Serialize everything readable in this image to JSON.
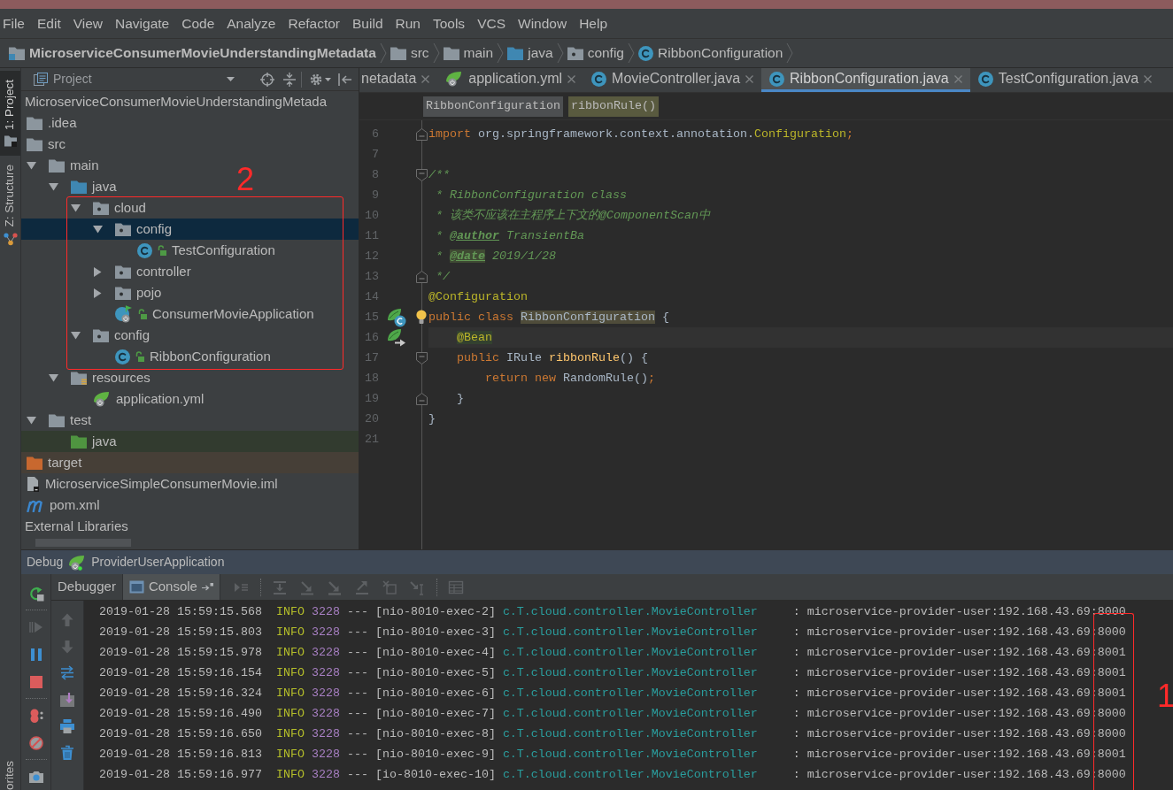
{
  "menu_bar": [
    {
      "label": "File"
    },
    {
      "label": "Edit"
    },
    {
      "label": "View"
    },
    {
      "label": "Navigate"
    },
    {
      "label": "Code"
    },
    {
      "label": "Analyze"
    },
    {
      "label": "Refactor"
    },
    {
      "label": "Build"
    },
    {
      "label": "Run"
    },
    {
      "label": "Tools"
    },
    {
      "label": "VCS"
    },
    {
      "label": "Window"
    },
    {
      "label": "Help"
    }
  ],
  "navigation_bar": [
    {
      "label": "MicroserviceConsumerMovieUnderstandingMetadata",
      "kind": "module"
    },
    {
      "label": "src",
      "kind": "folder"
    },
    {
      "label": "main",
      "kind": "folder"
    },
    {
      "label": "java",
      "kind": "source_root"
    },
    {
      "label": "config",
      "kind": "package"
    },
    {
      "label": "RibbonConfiguration",
      "kind": "class"
    }
  ],
  "tool_strip": {
    "top": [
      {
        "label": "1: Project",
        "kind": "project",
        "selected": true
      },
      {
        "label": "Z: Structure",
        "kind": "structure",
        "selected": false
      }
    ],
    "bottom": [
      {
        "label": "orites"
      }
    ]
  },
  "project_panel": {
    "title": "Project",
    "annotation": {
      "label": "2"
    },
    "tree": [
      {
        "label": "MicroserviceConsumerMovieUnderstandingMetada",
        "selected": false,
        "children": [
          {
            "label": ".idea",
            "kind": "folder",
            "selected": false
          },
          {
            "label": "src",
            "kind": "folder",
            "selected": false,
            "children": [
              {
                "label": "main",
                "kind": "folder",
                "expanded": true,
                "selected": false,
                "children": [
                  {
                    "label": "java",
                    "kind": "source_root",
                    "expanded": true,
                    "selected": false,
                    "children": [
                      {
                        "label": "cloud",
                        "kind": "package",
                        "expanded": true,
                        "selected": false,
                        "children": [
                          {
                            "label": "config",
                            "kind": "package",
                            "expanded": true,
                            "selected": true,
                            "children": [
                              {
                                "label": "TestConfiguration",
                                "kind": "class",
                                "selected": false
                              }
                            ]
                          },
                          {
                            "label": "controller",
                            "kind": "package",
                            "expanded": false,
                            "selected": false
                          },
                          {
                            "label": "pojo",
                            "kind": "package",
                            "expanded": false,
                            "selected": false
                          },
                          {
                            "label": "ConsumerMovieApplication",
                            "kind": "boot_class",
                            "selected": false
                          }
                        ]
                      },
                      {
                        "label": "config",
                        "kind": "package",
                        "expanded": true,
                        "selected": false,
                        "children": [
                          {
                            "label": "RibbonConfiguration",
                            "kind": "class",
                            "selected": false
                          }
                        ]
                      }
                    ]
                  },
                  {
                    "label": "resources",
                    "kind": "resources_root",
                    "expanded": true,
                    "selected": false,
                    "children": [
                      {
                        "label": "application.yml",
                        "kind": "yml",
                        "selected": false
                      }
                    ]
                  }
                ]
              },
              {
                "label": "test",
                "kind": "folder",
                "expanded": true,
                "selected": false,
                "children": [
                  {
                    "label": "java",
                    "kind": "test_root",
                    "selected": false
                  }
                ]
              }
            ]
          },
          {
            "label": "target",
            "kind": "excluded",
            "selected": false
          },
          {
            "label": "MicroserviceSimpleConsumerMovie.iml",
            "kind": "iml",
            "selected": false
          },
          {
            "label": "pom.xml",
            "kind": "pom",
            "selected": false
          }
        ]
      },
      {
        "label": "External Libraries",
        "selected": false
      }
    ]
  },
  "editor": {
    "tabs": [
      {
        "label": "netadata",
        "kind": "clipped",
        "selected": false
      },
      {
        "label": "application.yml",
        "kind": "yml",
        "selected": false
      },
      {
        "label": "MovieController.java",
        "kind": "class",
        "selected": false
      },
      {
        "label": "RibbonConfiguration.java",
        "kind": "class",
        "selected": true
      },
      {
        "label": "TestConfiguration.java",
        "kind": "class",
        "selected": false
      }
    ],
    "breadcrumbs": [
      {
        "label": "RibbonConfiguration",
        "kind": "class"
      },
      {
        "label": "ribbonRule()",
        "kind": "method"
      }
    ],
    "lines": [
      {
        "number": "6",
        "fold_marker": {
          "kind": "end"
        },
        "current": false,
        "bulb": false,
        "tokens": [
          {
            "text": "import",
            "kind": "keyword",
            "highlighted": false
          },
          {
            "text": " org.springframework.context.annotation.",
            "kind": "plain",
            "highlighted": false
          },
          {
            "text": "Configuration",
            "kind": "annotation",
            "highlighted": false
          },
          {
            "text": ";",
            "kind": "keyword",
            "highlighted": false
          }
        ]
      },
      {
        "number": "7",
        "current": false,
        "bulb": false
      },
      {
        "number": "8",
        "fold_marker": {
          "kind": "start"
        },
        "current": false,
        "bulb": false,
        "tokens": [
          {
            "text": "/**",
            "kind": "comment",
            "highlighted": false
          }
        ]
      },
      {
        "number": "9",
        "current": false,
        "bulb": false,
        "tokens": [
          {
            "text": " * RibbonConfiguration class",
            "kind": "comment",
            "highlighted": false
          }
        ]
      },
      {
        "number": "10",
        "current": false,
        "bulb": false,
        "tokens": [
          {
            "text": " * 该类不应该在主程序上下文的@ComponentScan中",
            "kind": "comment",
            "highlighted": false
          }
        ]
      },
      {
        "number": "11",
        "current": false,
        "bulb": false,
        "tokens": [
          {
            "text": " * ",
            "kind": "comment",
            "highlighted": false
          },
          {
            "text": "@author",
            "kind": "doc_tag",
            "highlighted": false
          },
          {
            "text": " TransientBa",
            "kind": "comment",
            "highlighted": false
          }
        ]
      },
      {
        "number": "12",
        "current": false,
        "bulb": false,
        "tokens": [
          {
            "text": " * ",
            "kind": "comment",
            "highlighted": false
          },
          {
            "text": "@date",
            "kind": "doc_tag",
            "highlighted": true
          },
          {
            "text": " 2019/1/28",
            "kind": "comment",
            "highlighted": false
          }
        ]
      },
      {
        "number": "13",
        "fold_marker": {
          "kind": "end"
        },
        "current": false,
        "bulb": false,
        "tokens": [
          {
            "text": " */",
            "kind": "comment",
            "highlighted": false
          }
        ]
      },
      {
        "number": "14",
        "current": false,
        "bulb": false,
        "tokens": [
          {
            "text": "@Configuration",
            "kind": "annotation",
            "highlighted": false
          }
        ]
      },
      {
        "number": "15",
        "gutter_icon": {
          "kind": "bean_class"
        },
        "current": false,
        "bulb": true,
        "tokens": [
          {
            "text": "public class ",
            "kind": "keyword",
            "highlighted": false
          },
          {
            "text": "RibbonConfiguration",
            "kind": "plain",
            "highlighted": true
          },
          {
            "text": " {",
            "kind": "plain",
            "highlighted": false
          }
        ]
      },
      {
        "number": "16",
        "gutter_icon": {
          "kind": "bean_method"
        },
        "current": true,
        "bulb": false,
        "tokens": [
          {
            "text": "    @Bean",
            "kind": "annotation",
            "highlighted": true
          }
        ]
      },
      {
        "number": "17",
        "fold_marker": {
          "kind": "start"
        },
        "current": false,
        "bulb": false,
        "tokens": [
          {
            "text": "    public ",
            "kind": "keyword",
            "highlighted": false
          },
          {
            "text": "IRule ",
            "kind": "plain",
            "highlighted": false
          },
          {
            "text": "ribbonRule",
            "kind": "method",
            "highlighted": false
          },
          {
            "text": "() {",
            "kind": "plain",
            "highlighted": false
          }
        ]
      },
      {
        "number": "18",
        "current": false,
        "bulb": false,
        "tokens": [
          {
            "text": "        return new ",
            "kind": "keyword",
            "highlighted": false
          },
          {
            "text": "RandomRule()",
            "kind": "plain",
            "highlighted": false
          },
          {
            "text": ";",
            "kind": "keyword",
            "highlighted": false
          }
        ]
      },
      {
        "number": "19",
        "fold_marker": {
          "kind": "end"
        },
        "current": false,
        "bulb": false,
        "tokens": [
          {
            "text": "    }",
            "kind": "plain",
            "highlighted": false
          }
        ]
      },
      {
        "number": "20",
        "current": false,
        "bulb": false,
        "tokens": [
          {
            "text": "}",
            "kind": "plain",
            "highlighted": false
          }
        ]
      },
      {
        "number": "21",
        "current": false,
        "bulb": false
      }
    ]
  },
  "debug_panel": {
    "title": "Debug",
    "configuration": "ProviderUserApplication",
    "actions": [
      [
        {
          "kind": "rerun",
          "disabled": false
        }
      ],
      [
        {
          "kind": "resume",
          "disabled": true
        },
        {
          "kind": "pause",
          "disabled": false
        },
        {
          "kind": "stop",
          "disabled": false
        }
      ],
      [
        {
          "kind": "breakpoints",
          "disabled": false
        },
        {
          "kind": "mute",
          "disabled": false
        }
      ],
      [
        {
          "kind": "camera",
          "disabled": false
        }
      ]
    ],
    "tabs": [
      {
        "label": "Debugger",
        "kind": "debugger",
        "selected": false
      },
      {
        "label": "Console",
        "kind": "console",
        "selected": true
      }
    ],
    "toolbar": [
      [
        {
          "kind": "execution_point",
          "disabled": true
        }
      ],
      [
        {
          "kind": "step_over",
          "disabled": true
        },
        {
          "kind": "step_into",
          "disabled": true
        },
        {
          "kind": "force_step_into",
          "disabled": true
        },
        {
          "kind": "step_out",
          "disabled": true
        },
        {
          "kind": "drop_frame",
          "disabled": true
        },
        {
          "kind": "run_to_cursor",
          "disabled": true
        }
      ],
      [
        {
          "kind": "evaluate",
          "disabled": true
        }
      ]
    ],
    "console_actions": [
      {
        "kind": "up",
        "disabled": true
      },
      {
        "kind": "down",
        "disabled": true
      },
      {
        "kind": "soft_wrap",
        "disabled": false
      },
      {
        "kind": "scroll_to_end",
        "disabled": false
      },
      {
        "kind": "print",
        "disabled": false
      },
      {
        "kind": "clear",
        "disabled": false
      }
    ],
    "console": {
      "annotation": {
        "label": "1"
      },
      "rows": [
        {
          "time": "2019-01-28 15:59:15.568",
          "severity": "INFO",
          "pid": "3228",
          "separator": "---",
          "thread": "[nio-8010-exec-2]",
          "logger": "c.T.cloud.controller.MovieController",
          "colon": ":",
          "message": "microservice-provider-user:192.168.43.69:8000"
        },
        {
          "time": "2019-01-28 15:59:15.803",
          "severity": "INFO",
          "pid": "3228",
          "separator": "---",
          "thread": "[nio-8010-exec-3]",
          "logger": "c.T.cloud.controller.MovieController",
          "colon": ":",
          "message": "microservice-provider-user:192.168.43.69:8000"
        },
        {
          "time": "2019-01-28 15:59:15.978",
          "severity": "INFO",
          "pid": "3228",
          "separator": "---",
          "thread": "[nio-8010-exec-4]",
          "logger": "c.T.cloud.controller.MovieController",
          "colon": ":",
          "message": "microservice-provider-user:192.168.43.69:8001"
        },
        {
          "time": "2019-01-28 15:59:16.154",
          "severity": "INFO",
          "pid": "3228",
          "separator": "---",
          "thread": "[nio-8010-exec-5]",
          "logger": "c.T.cloud.controller.MovieController",
          "colon": ":",
          "message": "microservice-provider-user:192.168.43.69:8001"
        },
        {
          "time": "2019-01-28 15:59:16.324",
          "severity": "INFO",
          "pid": "3228",
          "separator": "---",
          "thread": "[nio-8010-exec-6]",
          "logger": "c.T.cloud.controller.MovieController",
          "colon": ":",
          "message": "microservice-provider-user:192.168.43.69:8001"
        },
        {
          "time": "2019-01-28 15:59:16.490",
          "severity": "INFO",
          "pid": "3228",
          "separator": "---",
          "thread": "[nio-8010-exec-7]",
          "logger": "c.T.cloud.controller.MovieController",
          "colon": ":",
          "message": "microservice-provider-user:192.168.43.69:8000"
        },
        {
          "time": "2019-01-28 15:59:16.650",
          "severity": "INFO",
          "pid": "3228",
          "separator": "---",
          "thread": "[nio-8010-exec-8]",
          "logger": "c.T.cloud.controller.MovieController",
          "colon": ":",
          "message": "microservice-provider-user:192.168.43.69:8000"
        },
        {
          "time": "2019-01-28 15:59:16.813",
          "severity": "INFO",
          "pid": "3228",
          "separator": "---",
          "thread": "[nio-8010-exec-9]",
          "logger": "c.T.cloud.controller.MovieController",
          "colon": ":",
          "message": "microservice-provider-user:192.168.43.69:8001"
        },
        {
          "time": "2019-01-28 15:59:16.977",
          "severity": "INFO",
          "pid": "3228",
          "separator": "---",
          "thread": "[io-8010-exec-10]",
          "logger": "c.T.cloud.controller.MovieController",
          "colon": ":",
          "message": "microservice-provider-user:192.168.43.69:8000"
        }
      ]
    }
  }
}
